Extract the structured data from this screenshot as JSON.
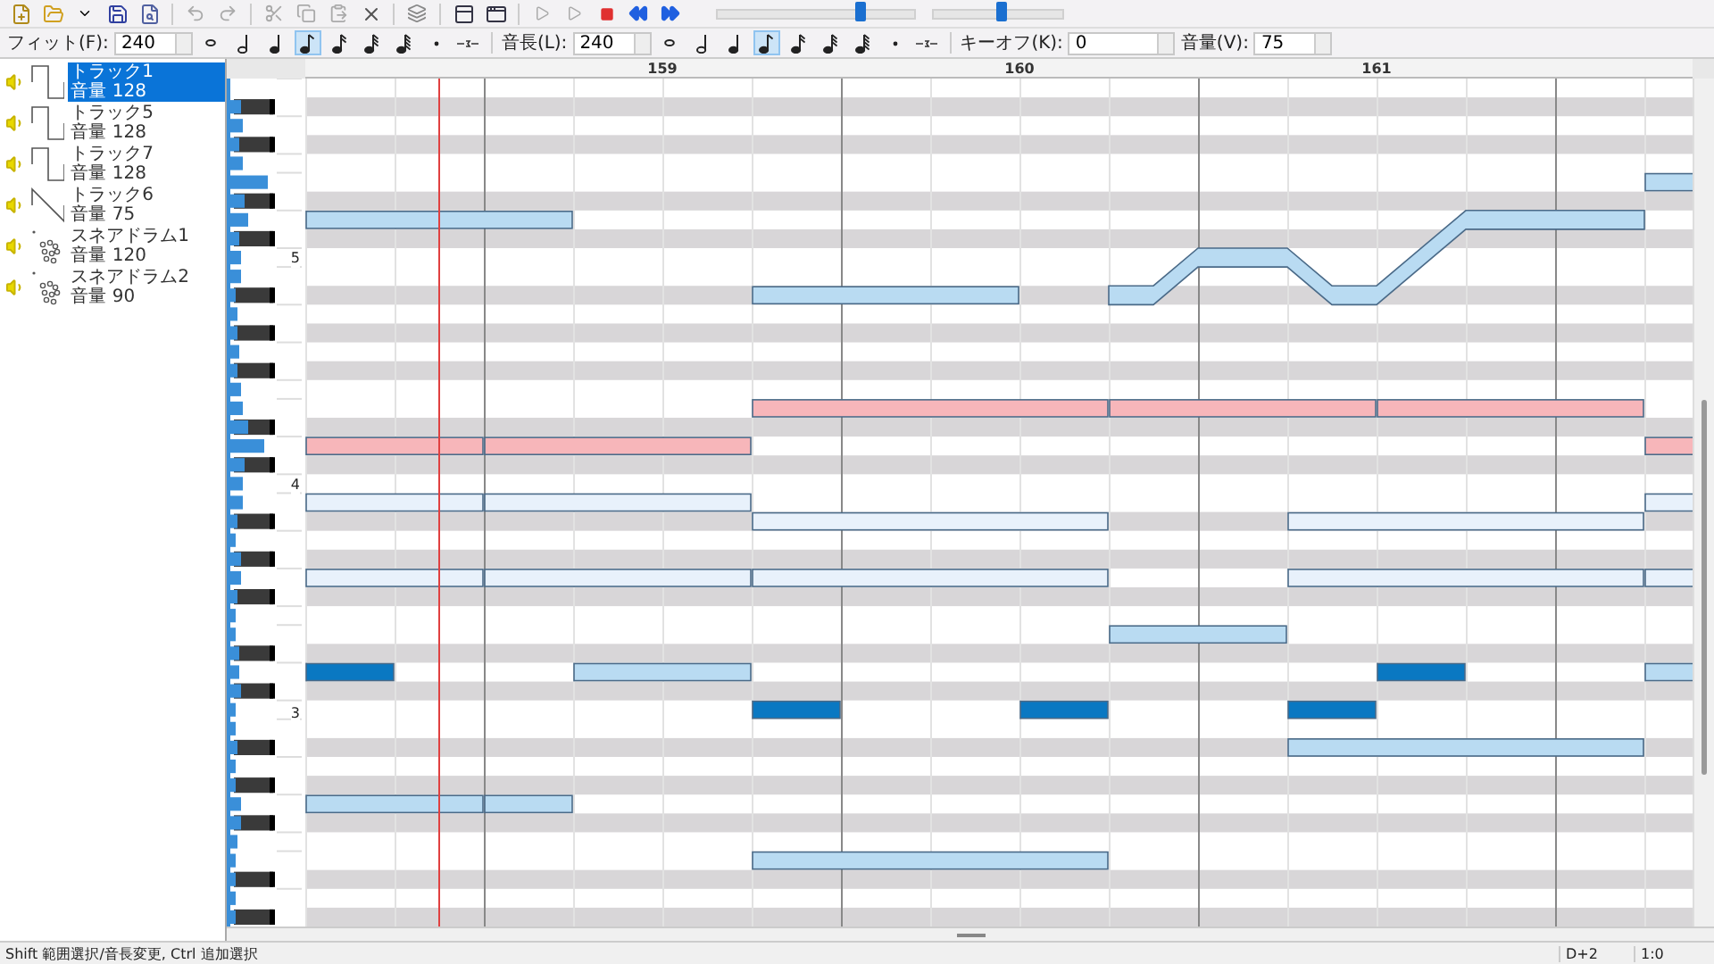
{
  "toolbar": {
    "sliders": [
      {
        "level": 0.73
      },
      {
        "level": 0.53
      }
    ]
  },
  "note_bar": {
    "fit_label": "フィット(F):",
    "fit_value": "240",
    "fit_buttons": [
      {
        "kind": "whole",
        "selected": false
      },
      {
        "kind": "half",
        "selected": false
      },
      {
        "kind": "quarter",
        "selected": false
      },
      {
        "kind": "eighth",
        "selected": true
      },
      {
        "kind": "sixteenth",
        "selected": false
      },
      {
        "kind": "thirtysecond",
        "selected": false
      },
      {
        "kind": "sixtyfourth",
        "selected": false
      }
    ],
    "length_label": "音長(L):",
    "length_value": "240",
    "length_buttons": [
      {
        "kind": "whole",
        "selected": false
      },
      {
        "kind": "half",
        "selected": false
      },
      {
        "kind": "quarter",
        "selected": false
      },
      {
        "kind": "eighth",
        "selected": true
      },
      {
        "kind": "sixteenth",
        "selected": false
      },
      {
        "kind": "thirtysecond",
        "selected": false
      },
      {
        "kind": "sixtyfourth",
        "selected": false
      }
    ],
    "keyoff_label": "キーオフ(K):",
    "keyoff_value": "0",
    "volume_label": "音量(V):",
    "volume_value": "75"
  },
  "tracks": [
    {
      "name": "トラック1",
      "volume": "音量 128",
      "kind": "square",
      "selected": true
    },
    {
      "name": "トラック5",
      "volume": "音量 128",
      "kind": "square",
      "selected": false
    },
    {
      "name": "トラック7",
      "volume": "音量 128",
      "kind": "square",
      "selected": false
    },
    {
      "name": "トラック6",
      "volume": "音量 75",
      "kind": "saw",
      "selected": false
    },
    {
      "name": "スネアドラム1",
      "volume": "音量 120",
      "kind": "noise",
      "selected": false
    },
    {
      "name": "スネアドラム2",
      "volume": "音量 90",
      "kind": "noise",
      "selected": false
    }
  ],
  "keyboard": {
    "octave_labels": [
      "5",
      "4",
      "3"
    ]
  },
  "ruler": {
    "measures": [
      "159",
      "160",
      "161"
    ]
  },
  "status_bar": {
    "hint": "Shift 範囲選択/音長変更, Ctrl 追加選択",
    "key": "D+2",
    "position": "1:0"
  }
}
